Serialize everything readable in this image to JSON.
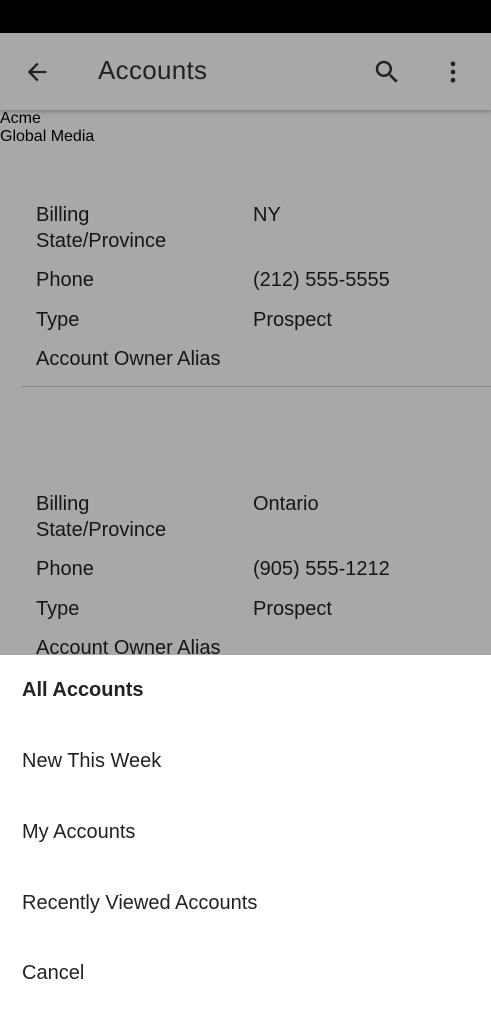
{
  "header": {
    "title": "Accounts"
  },
  "records": [
    {
      "name": "Acme",
      "fields": [
        {
          "label": "Billing State/Province",
          "value": "NY"
        },
        {
          "label": "Phone",
          "value": "(212) 555-5555"
        },
        {
          "label": "Type",
          "value": "Prospect"
        },
        {
          "label": "Account Owner Alias",
          "value": ""
        }
      ]
    },
    {
      "name": "Global Media",
      "fields": [
        {
          "label": "Billing State/Province",
          "value": "Ontario"
        },
        {
          "label": "Phone",
          "value": "(905) 555-1212"
        },
        {
          "label": "Type",
          "value": "Prospect"
        },
        {
          "label": "Account Owner Alias",
          "value": ""
        }
      ]
    }
  ],
  "sheet": {
    "items": [
      "All Accounts",
      "New This Week",
      "My Accounts",
      "Recently Viewed Accounts",
      "Cancel"
    ]
  },
  "colors": {
    "link": "#3b6fd4",
    "chip": "#e3e3e3",
    "status_bar": "#000000"
  },
  "icons": [
    "arrow-back-icon",
    "search-icon",
    "more-vert-icon"
  ]
}
